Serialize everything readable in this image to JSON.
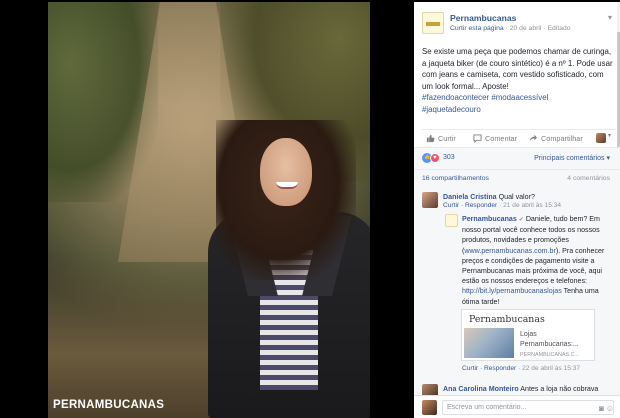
{
  "photo": {
    "brand": "PERNAMBUCANAS"
  },
  "post": {
    "page_name": "Pernambucanas",
    "like_page": "Curtir esta página",
    "date": "20 de abril",
    "edited": "Editado",
    "text": "Se existe uma peça que podemos chamar de curinga, a jaqueta biker (de couro sintético) é a nº 1. Pode usar com jeans e camiseta, com vestido sofisticado, com um look formal... Aposte!",
    "hashtags": [
      "#fazendoacontecer #modaacessível",
      "#jaquetadecouro"
    ]
  },
  "actions": {
    "like": "Curtir",
    "comment": "Comentar",
    "share": "Compartilhar"
  },
  "reactions": {
    "count": "303",
    "order": "Principais comentários"
  },
  "shares": {
    "label": "16 compartilhamentos",
    "comments": "4 comentários"
  },
  "comments": [
    {
      "name": "Daniela Cristina",
      "text": "Qual valor?",
      "reply": "Curtir · Responder",
      "date": "21 de abril às 15:34"
    },
    {
      "name": "Pernambucanas",
      "text_a": "Daniele, tudo bem? Em nosso portal você conhece todos os nossos produtos, novidades e promoções (",
      "url": "www.pernambucanas.com.br",
      "text_b": "). Pra conhecer preços e condições de pagamento visite a Pernambucanas mais próxima de você, aqui estão os nossos endereços e telefones:",
      "link": "http://bit.ly/pernambucanaslojas",
      "text_c": "Tenha uma ótima tarde!",
      "reply": "Curtir · Responder",
      "date": "22 de abril às 15:37",
      "card": {
        "title": "Pernambucanas",
        "sub1": "Lojas",
        "sub2": "Pernambucanas:...",
        "domain": "PERNAMBUCANAS.C..."
      }
    },
    {
      "name": "Ana Carolina Monteiro",
      "text": "Antes a loja não cobrava"
    }
  ],
  "write": {
    "placeholder": "Escreva um comentário..."
  }
}
